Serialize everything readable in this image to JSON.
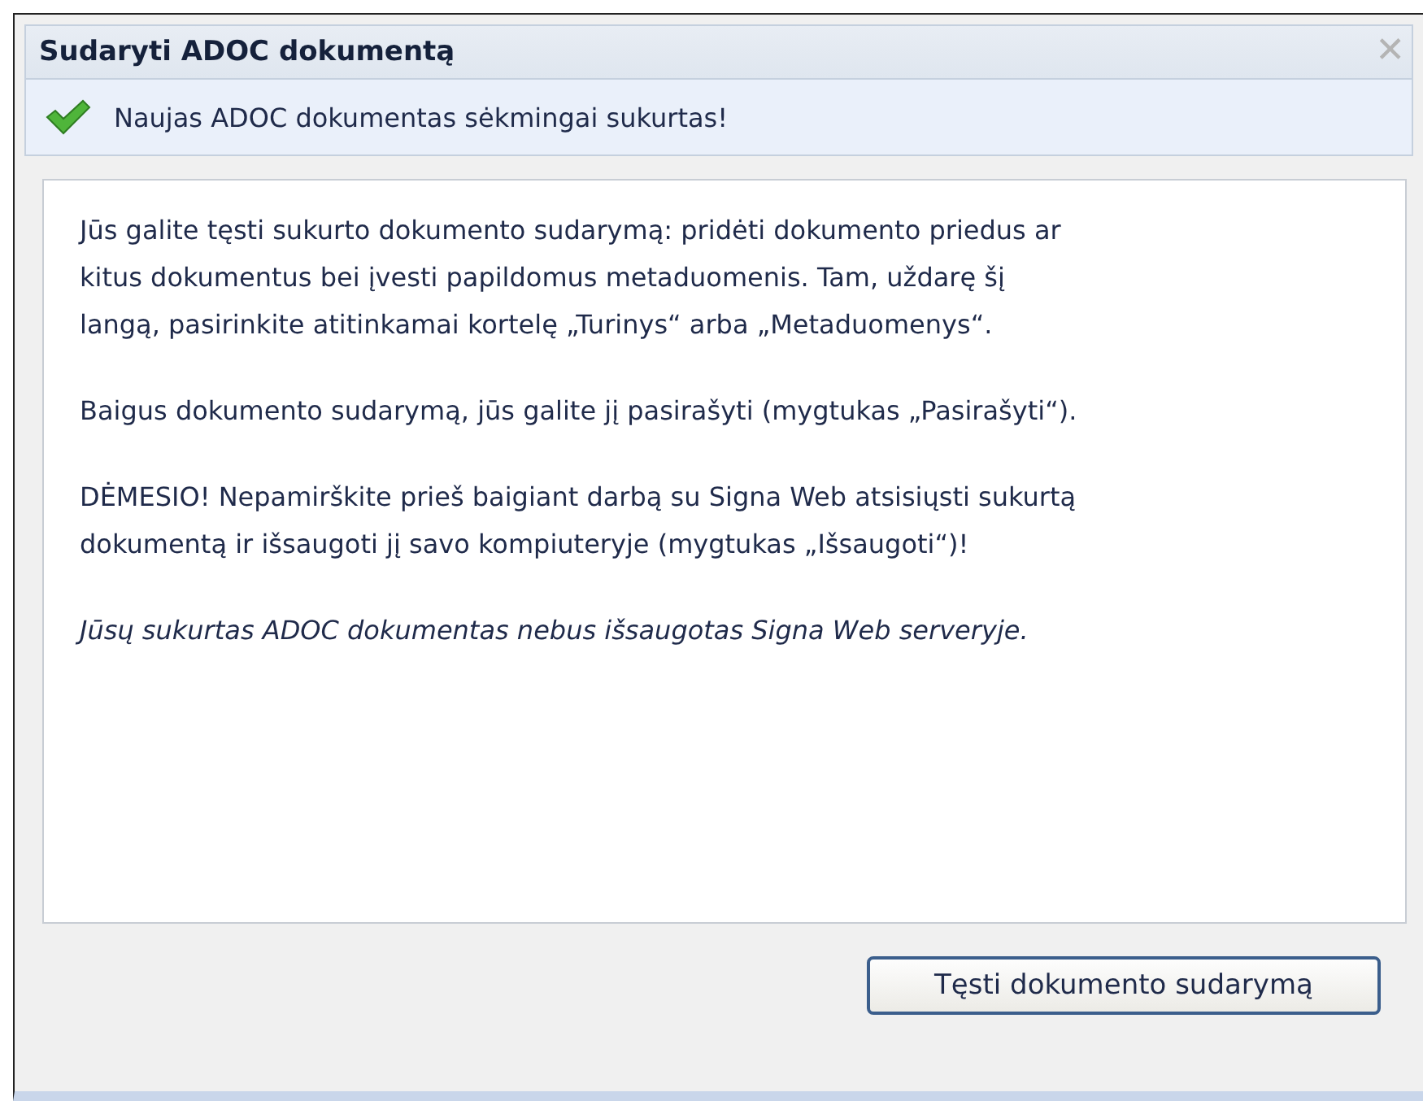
{
  "window": {
    "title": "Sudaryti ADOC dokumentą",
    "close_icon": "✕"
  },
  "notice": {
    "text": "Naujas ADOC dokumentas sėkmingai sukurtas!"
  },
  "paragraphs": [
    {
      "kind": "normal",
      "lines": [
        "Jūs galite tęsti sukurto dokumento sudarymą: pridėti dokumento priedus ar",
        "kitus dokumentus bei įvesti papildomus metaduomenis. Tam, uždarę šį",
        "langą, pasirinkite atitinkamai kortelę „Turinys“ arba „Metaduomenys“."
      ]
    },
    {
      "kind": "normal",
      "lines": [
        "Baigus dokumento sudarymą, jūs galite jį pasirašyti (mygtukas „Pasirašyti“)."
      ]
    },
    {
      "kind": "normal",
      "lines": [
        "DĖMESIO! Nepamirškite prieš baigiant darbą su Signa Web atsisiųsti sukurtą",
        "dokumentą ir išsaugoti jį savo kompiuteryje (mygtukas „Išsaugoti“)!"
      ]
    },
    {
      "kind": "italic",
      "lines": [
        "Jūsų sukurtas ADOC dokumentas nebus išsaugotas Signa Web serveryje."
      ]
    }
  ],
  "buttons": [
    "Tęsti dokumento sudarymą"
  ]
}
